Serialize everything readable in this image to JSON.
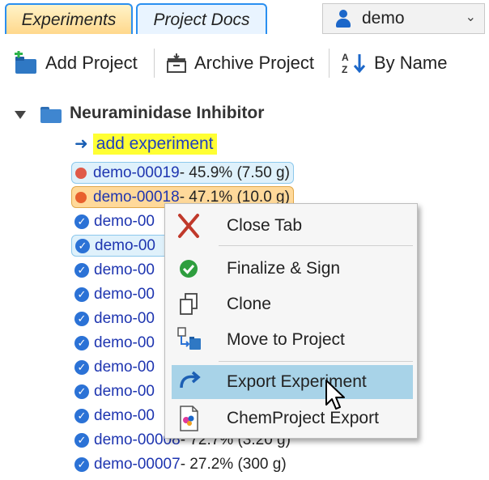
{
  "tabs": [
    {
      "label": "Experiments",
      "active": true
    },
    {
      "label": "Project Docs",
      "active": false
    }
  ],
  "user": {
    "name": "demo",
    "icon": "person-icon"
  },
  "toolbar": {
    "add_project": "Add Project",
    "archive_project": "Archive Project",
    "sort": "By Name"
  },
  "project": {
    "name": "Neuraminidase Inhibitor",
    "add_experiment": "add experiment"
  },
  "experiments": [
    {
      "id": "demo-00019",
      "rest": " - 45.9% (7.50 g)",
      "status": "red-dot"
    },
    {
      "id": "demo-00018",
      "rest": " - 47.1% (10.0 g)",
      "status": "orange-dot"
    },
    {
      "id": "demo-00",
      "rest": "",
      "status": "check"
    },
    {
      "id": "demo-00",
      "rest": "",
      "status": "check"
    },
    {
      "id": "demo-00",
      "rest": "",
      "status": "check"
    },
    {
      "id": "demo-00",
      "rest": "",
      "status": "check"
    },
    {
      "id": "demo-00",
      "rest": "",
      "status": "check"
    },
    {
      "id": "demo-00",
      "rest": "",
      "status": "check"
    },
    {
      "id": "demo-00",
      "rest": "",
      "status": "check"
    },
    {
      "id": "demo-00",
      "rest": "",
      "status": "check"
    },
    {
      "id": "demo-00",
      "rest": "",
      "status": "check"
    },
    {
      "id": "demo-00008",
      "rest": " - 72.7% (3.20 g)",
      "status": "check"
    },
    {
      "id": "demo-00007",
      "rest": " - 27.2% (300 g)",
      "status": "check"
    }
  ],
  "context_menu": {
    "close_tab": "Close Tab",
    "finalize": "Finalize & Sign",
    "clone": "Clone",
    "move": "Move to Project",
    "export": "Export Experiment",
    "chemproject": "ChemProject Export"
  },
  "colors": {
    "tab_border": "#2a8ff0",
    "link_blue": "#1e35b0",
    "highlight_yellow": "#ffff33",
    "menu_hover": "#a8d3e8"
  }
}
